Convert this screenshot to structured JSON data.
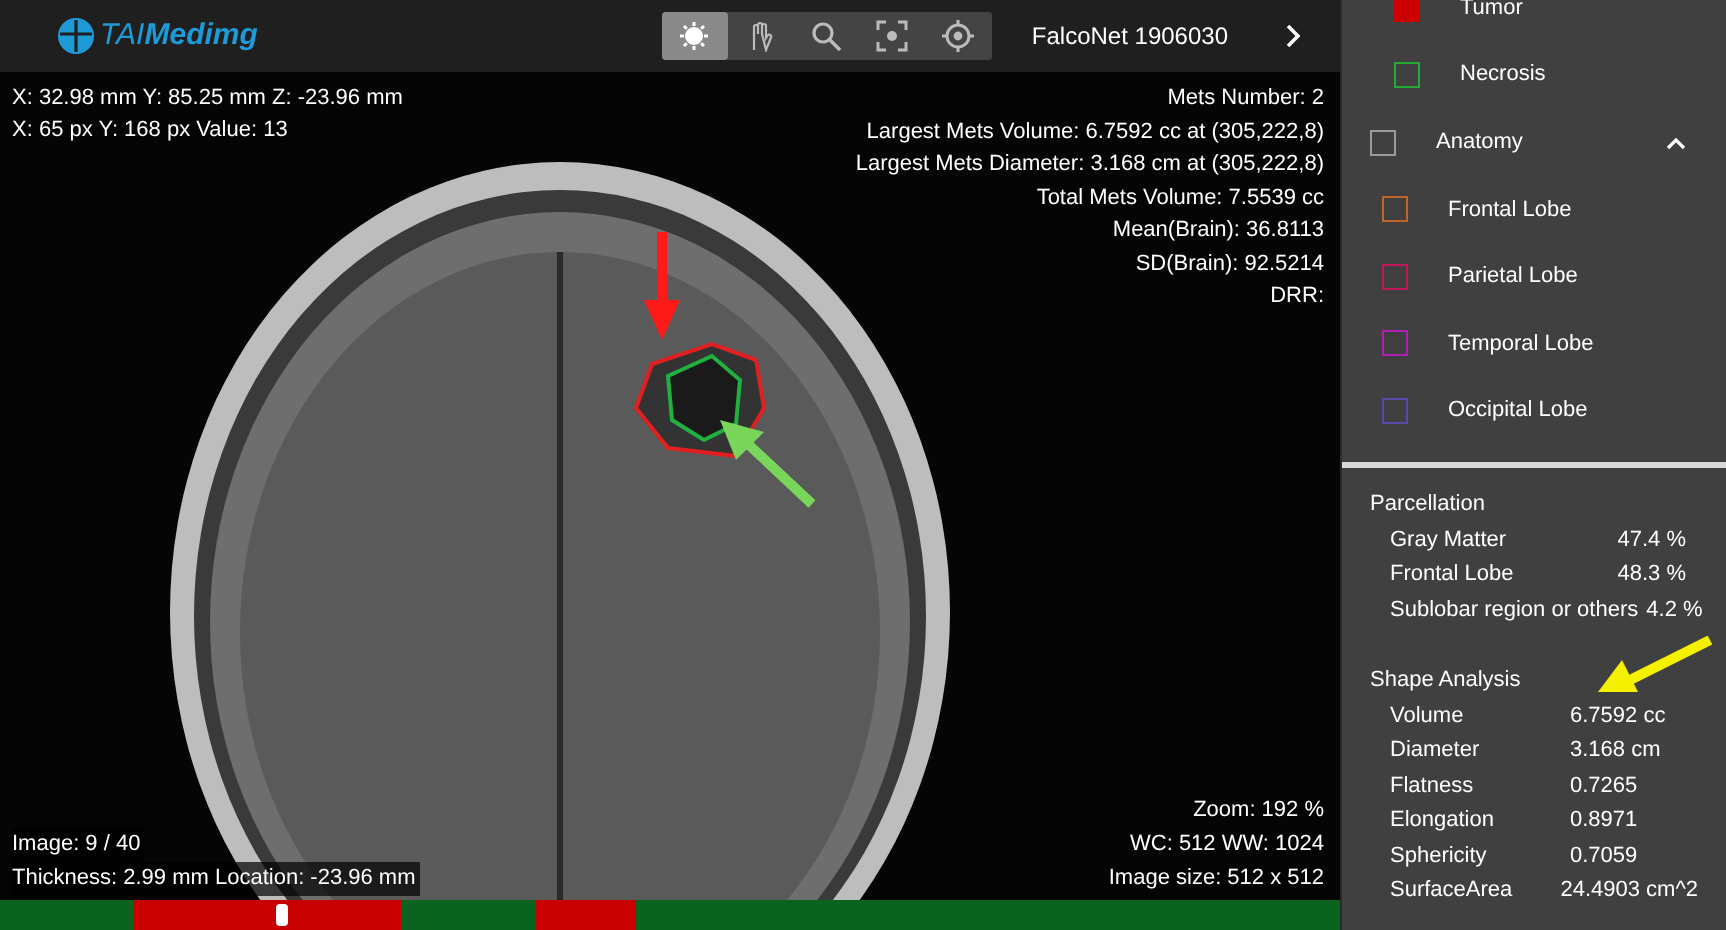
{
  "header": {
    "logo": "TAI**Medimg**",
    "tools": [
      {
        "kind": "contrast",
        "selected": true
      },
      {
        "kind": "hand",
        "selected": false
      },
      {
        "kind": "zoom",
        "selected": false
      },
      {
        "kind": "focus",
        "selected": false
      },
      {
        "kind": "target",
        "selected": false
      }
    ],
    "series_title": "FalcoNet 1906030"
  },
  "viewer": {
    "top_left": [
      "X: 32.98 mm Y: 85.25 mm Z: -23.96 mm",
      "X: 65 px Y: 168 px Value: 13"
    ],
    "top_right": [
      "Mets Number: 2",
      "Largest Mets Volume: 6.7592 cc at (305,222,8)",
      "Largest Mets Diameter: 3.168 cm at (305,222,8)",
      "Total Mets Volume: 7.5539 cc",
      "Mean(Brain): 36.8113",
      "SD(Brain): 92.5214",
      "DRR:"
    ],
    "bottom_left": [
      "Image: 9 / 40",
      "Thickness: 2.99 mm Location: -23.96 mm"
    ],
    "bottom_right": [
      "Zoom: 192 %",
      "WC: 512 WW: 1024",
      "Image size: 512 x 512"
    ]
  },
  "slice_bar": {
    "level": 0.21,
    "slices": [
      {
        "tumor": false
      },
      {
        "tumor": false
      },
      {
        "tumor": false
      },
      {
        "tumor": false
      },
      {
        "tumor": true
      },
      {
        "tumor": true
      },
      {
        "tumor": true
      },
      {
        "tumor": true
      },
      {
        "tumor": true
      },
      {
        "tumor": true
      },
      {
        "tumor": true
      },
      {
        "tumor": true
      },
      {
        "tumor": false
      },
      {
        "tumor": false
      },
      {
        "tumor": false
      },
      {
        "tumor": false
      },
      {
        "tumor": true
      },
      {
        "tumor": true
      },
      {
        "tumor": true
      },
      {
        "tumor": false
      },
      {
        "tumor": false
      },
      {
        "tumor": false
      },
      {
        "tumor": false
      },
      {
        "tumor": false
      },
      {
        "tumor": false
      },
      {
        "tumor": false
      },
      {
        "tumor": false
      },
      {
        "tumor": false
      },
      {
        "tumor": false
      },
      {
        "tumor": false
      },
      {
        "tumor": false
      },
      {
        "tumor": false
      },
      {
        "tumor": false
      },
      {
        "tumor": false
      },
      {
        "tumor": false
      },
      {
        "tumor": false
      },
      {
        "tumor": false
      },
      {
        "tumor": false
      },
      {
        "tumor": false
      },
      {
        "tumor": false
      }
    ]
  },
  "labels": [
    {
      "label": "Tumor",
      "kind": "sub",
      "color": "#cc0000",
      "checked": true
    },
    {
      "label": "Necrosis",
      "kind": "sub",
      "color": "#22aa33",
      "checked": false
    },
    {
      "label": "Anatomy",
      "kind": "group",
      "color": "#9a9a9a",
      "checked": false,
      "expanded": true
    },
    {
      "label": "Frontal Lobe",
      "kind": "item",
      "color": "#c0652a",
      "checked": false
    },
    {
      "label": "Parietal Lobe",
      "kind": "item",
      "color": "#c0185a",
      "checked": false
    },
    {
      "label": "Temporal Lobe",
      "kind": "item",
      "color": "#b020b0",
      "checked": false
    },
    {
      "label": "Occipital Lobe",
      "kind": "item",
      "color": "#5a4aa8",
      "checked": false
    }
  ],
  "parcellation": {
    "title": "Parcellation",
    "rows": [
      {
        "name": "Gray Matter",
        "value": "47.4 %"
      },
      {
        "name": "Frontal Lobe",
        "value": "48.3 %"
      },
      {
        "name": "Sublobar region or others",
        "value": "4.2 %"
      }
    ]
  },
  "shape_analysis": {
    "title": "Shape Analysis",
    "rows": [
      {
        "name": "Volume",
        "value": "6.7592 cc"
      },
      {
        "name": "Diameter",
        "value": "3.168 cm"
      },
      {
        "name": "Flatness",
        "value": "0.7265"
      },
      {
        "name": "Elongation",
        "value": "0.8971"
      },
      {
        "name": "Sphericity",
        "value": "0.7059"
      },
      {
        "name": "SurfaceArea",
        "value": "24.4903 cm^2"
      }
    ]
  }
}
